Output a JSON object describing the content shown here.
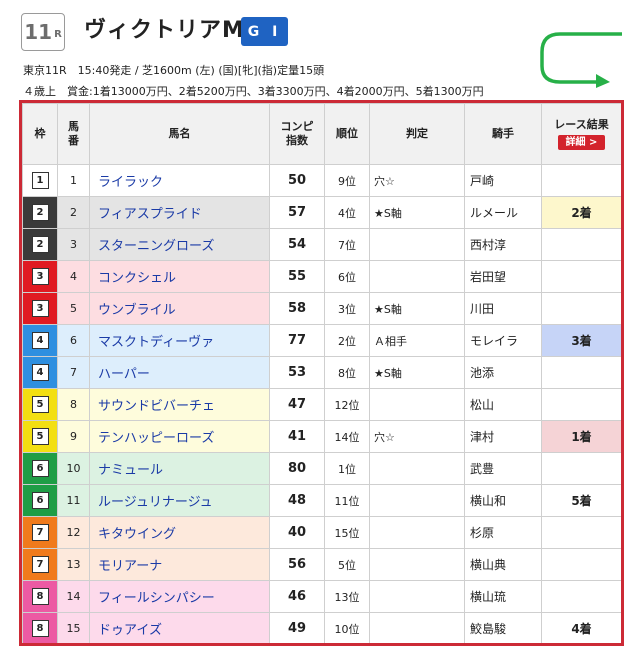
{
  "race": {
    "number": "11",
    "r_label": "R",
    "name": "ヴィクトリアM",
    "grade": "G I",
    "info_line1": "東京11R　15:40発走 / 芝1600m (左) (国)[牝](指)定量15頭",
    "info_line2": "４歳上　賞金:1着13000万円、2着5200万円、3着3300万円、4着2000万円、5着1300万円"
  },
  "table": {
    "headers": {
      "waku": "枠",
      "umaban": "馬\n番",
      "name": "馬名",
      "index": "コンピ\n指数",
      "rank": "順位",
      "judge": "判定",
      "jockey": "騎手",
      "result": "レース結果",
      "detail_button": "詳細 >"
    },
    "rows": [
      {
        "waku": "1",
        "umaban": "1",
        "name": "ライラック",
        "index": "50",
        "rank": "9位",
        "judge": "穴☆",
        "jockey": "戸崎",
        "result": ""
      },
      {
        "waku": "2",
        "umaban": "2",
        "name": "フィアスプライド",
        "index": "57",
        "rank": "4位",
        "judge": "★S軸",
        "jockey": "ルメール",
        "result": "2着"
      },
      {
        "waku": "2",
        "umaban": "3",
        "name": "スターニングローズ",
        "index": "54",
        "rank": "7位",
        "judge": "",
        "jockey": "西村淳",
        "result": ""
      },
      {
        "waku": "3",
        "umaban": "4",
        "name": "コンクシェル",
        "index": "55",
        "rank": "6位",
        "judge": "",
        "jockey": "岩田望",
        "result": ""
      },
      {
        "waku": "3",
        "umaban": "5",
        "name": "ウンブライル",
        "index": "58",
        "rank": "3位",
        "judge": "★S軸",
        "jockey": "川田",
        "result": ""
      },
      {
        "waku": "4",
        "umaban": "6",
        "name": "マスクトディーヴァ",
        "index": "77",
        "rank": "2位",
        "judge": "Ａ相手",
        "jockey": "モレイラ",
        "result": "3着"
      },
      {
        "waku": "4",
        "umaban": "7",
        "name": "ハーパー",
        "index": "53",
        "rank": "8位",
        "judge": "★S軸",
        "jockey": "池添",
        "result": ""
      },
      {
        "waku": "5",
        "umaban": "8",
        "name": "サウンドビバーチェ",
        "index": "47",
        "rank": "12位",
        "judge": "",
        "jockey": "松山",
        "result": ""
      },
      {
        "waku": "5",
        "umaban": "9",
        "name": "テンハッピーローズ",
        "index": "41",
        "rank": "14位",
        "judge": "穴☆",
        "jockey": "津村",
        "result": "1着"
      },
      {
        "waku": "6",
        "umaban": "10",
        "name": "ナミュール",
        "index": "80",
        "rank": "1位",
        "judge": "",
        "jockey": "武豊",
        "result": ""
      },
      {
        "waku": "6",
        "umaban": "11",
        "name": "ルージュリナージュ",
        "index": "48",
        "rank": "11位",
        "judge": "",
        "jockey": "横山和",
        "result": "5着"
      },
      {
        "waku": "7",
        "umaban": "12",
        "name": "キタウイング",
        "index": "40",
        "rank": "15位",
        "judge": "",
        "jockey": "杉原",
        "result": ""
      },
      {
        "waku": "7",
        "umaban": "13",
        "name": "モリアーナ",
        "index": "56",
        "rank": "5位",
        "judge": "",
        "jockey": "横山典",
        "result": ""
      },
      {
        "waku": "8",
        "umaban": "14",
        "name": "フィールシンパシー",
        "index": "46",
        "rank": "13位",
        "judge": "",
        "jockey": "横山琉",
        "result": ""
      },
      {
        "waku": "8",
        "umaban": "15",
        "name": "ドゥアイズ",
        "index": "49",
        "rank": "10位",
        "judge": "",
        "jockey": "鮫島駿",
        "result": "4着"
      }
    ]
  },
  "colors": {
    "frame_border": "#cc2a36",
    "grade_badge": "#1f63c2",
    "course_icon": "#27b048",
    "waku": {
      "1": {
        "cell": "#ffffff",
        "row": "#ffffff"
      },
      "2": {
        "cell": "#3a3a3a",
        "row": "#e4e4e4"
      },
      "3": {
        "cell": "#e01a22",
        "row": "#fddde1"
      },
      "4": {
        "cell": "#2e8fe0",
        "row": "#ddeefc"
      },
      "5": {
        "cell": "#f3df12",
        "row": "#fefcdc"
      },
      "6": {
        "cell": "#1f9d45",
        "row": "#dcf2e2"
      },
      "7": {
        "cell": "#f07a1c",
        "row": "#fde9dc"
      },
      "8": {
        "cell": "#ec5aa3",
        "row": "#fddaeb"
      }
    },
    "result_highlight": {
      "1着": "#f5d3d6",
      "2着": "#fdf7cc",
      "3着": "#c6d4f7"
    }
  }
}
